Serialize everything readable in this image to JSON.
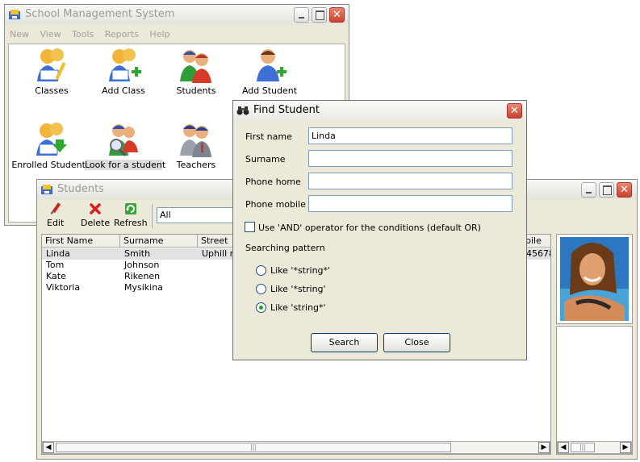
{
  "main_window": {
    "title": "School Management System",
    "menu": [
      "New",
      "View",
      "Tools",
      "Reports",
      "Help"
    ],
    "launchers": [
      {
        "label": "Classes",
        "icon": "classes-icon"
      },
      {
        "label": "Add Class",
        "icon": "add-class-icon"
      },
      {
        "label": "Students",
        "icon": "students-icon"
      },
      {
        "label": "Add Student",
        "icon": "add-student-icon"
      },
      {
        "label": "Enrolled Students",
        "icon": "enrolled-students-icon"
      },
      {
        "label": "Look for a student",
        "icon": "look-for-student-icon"
      },
      {
        "label": "Teachers",
        "icon": "teachers-icon"
      }
    ]
  },
  "students_window": {
    "title": "Students",
    "toolbar": {
      "edit": "Edit",
      "delete": "Delete",
      "refresh": "Refresh"
    },
    "filter_value": "All",
    "columns": [
      "First Name",
      "Surname",
      "Street"
    ],
    "partial_column": "bile",
    "rows": [
      {
        "first": "Linda",
        "surname": "Smith",
        "street": "Uphill rd",
        "mobile_tail": "45678"
      },
      {
        "first": "Tom",
        "surname": "Johnson",
        "street": "",
        "mobile_tail": ""
      },
      {
        "first": "Kate",
        "surname": "Rikenen",
        "street": "",
        "mobile_tail": ""
      },
      {
        "first": "Viktoria",
        "surname": "Mysikina",
        "street": "",
        "mobile_tail": ""
      }
    ]
  },
  "find_dialog": {
    "title": "Find Student",
    "fields": [
      {
        "label": "First name",
        "value": "Linda"
      },
      {
        "label": "Surname",
        "value": ""
      },
      {
        "label": "Phone home",
        "value": ""
      },
      {
        "label": "Phone mobile",
        "value": ""
      }
    ],
    "and_operator_label": "Use 'AND' operator for the conditions (default OR)",
    "pattern_heading": "Searching pattern",
    "patterns": [
      {
        "label": "Like '*string*'",
        "selected": false
      },
      {
        "label": "Like '*string'",
        "selected": false
      },
      {
        "label": "Like 'string*'",
        "selected": true
      }
    ],
    "search_button": "Search",
    "close_button": "Close"
  },
  "colors": {
    "accent": "#21a121",
    "close_red": "#c8442b",
    "window_bg": "#ece9d8"
  }
}
